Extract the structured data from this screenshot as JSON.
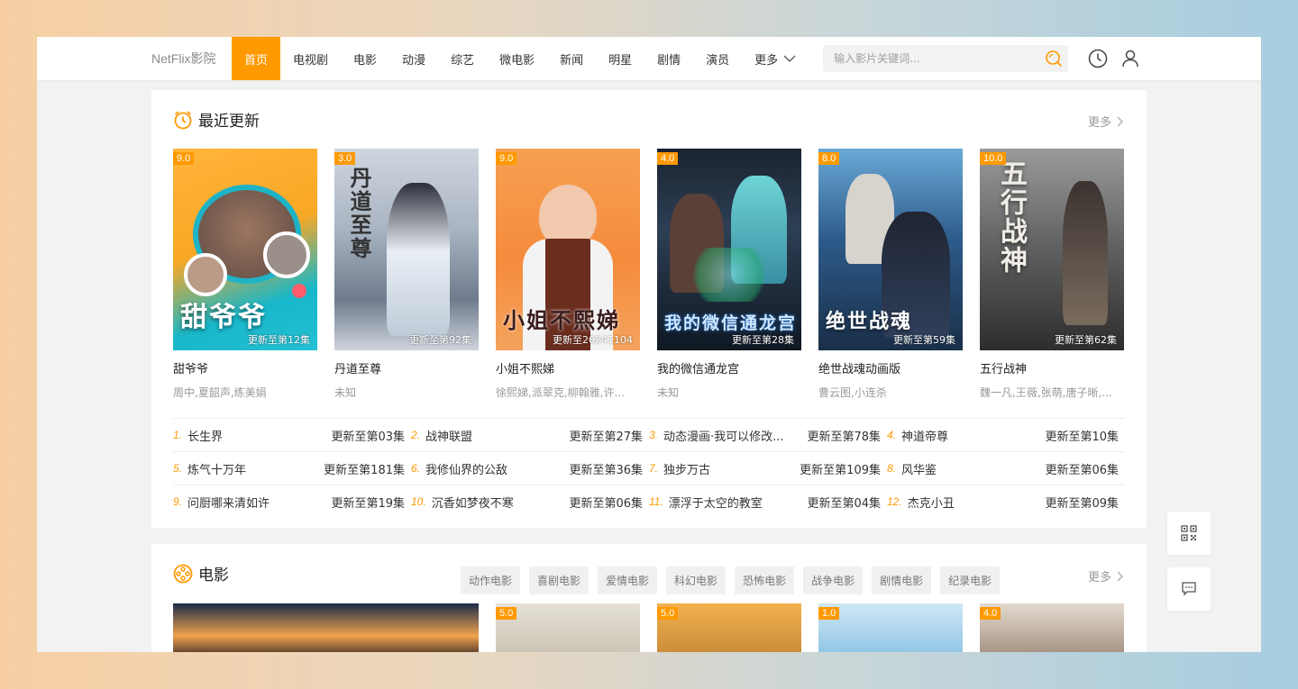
{
  "header": {
    "brand": "NetFlix影院",
    "nav": [
      {
        "label": "首页",
        "active": true
      },
      {
        "label": "电视剧"
      },
      {
        "label": "电影"
      },
      {
        "label": "动漫"
      },
      {
        "label": "综艺"
      },
      {
        "label": "微电影"
      },
      {
        "label": "新闻"
      },
      {
        "label": "明星"
      },
      {
        "label": "剧情"
      },
      {
        "label": "演员"
      },
      {
        "label": "更多"
      }
    ],
    "search_placeholder": "输入影片关键词..."
  },
  "recent": {
    "title": "最近更新",
    "more": "更多",
    "cards": [
      {
        "score": "9.0",
        "update": "更新至第12集",
        "art": "甜爷爷",
        "name": "甜爷爷",
        "actors": "周中,夏韶声,练美娟"
      },
      {
        "score": "3.0",
        "update": "更新至第92集",
        "art": "丹道至尊",
        "name": "丹道至尊",
        "actors": "未知"
      },
      {
        "score": "9.0",
        "update": "更新至20241104",
        "art": "小姐不熙娣",
        "name": "小姐不熙娣",
        "actors": "徐熙娣,派翠克,柳翰雅,许..."
      },
      {
        "score": "4.0",
        "update": "更新至第28集",
        "art": "我的微信通龙宫",
        "name": "我的微信通龙宫",
        "actors": "未知"
      },
      {
        "score": "8.0",
        "update": "更新至第59集",
        "art": "绝世战魂",
        "name": "绝世战魂动画版",
        "actors": "曹云图,小连杀"
      },
      {
        "score": "10.0",
        "update": "更新至第62集",
        "art": "五行战神",
        "name": "五行战神",
        "actors": "魏一凡,王薇,张萌,唐子晰,..."
      }
    ],
    "ranking": [
      {
        "num": "1.",
        "name": "长生界",
        "update": "更新至第03集"
      },
      {
        "num": "2.",
        "name": "战神联盟",
        "update": "更新至第27集"
      },
      {
        "num": "3.",
        "name": "动态漫画·我可以修改...",
        "update": "更新至第78集"
      },
      {
        "num": "4.",
        "name": "神道帝尊",
        "update": "更新至第10集"
      },
      {
        "num": "5.",
        "name": "炼气十万年",
        "update": "更新至第181集"
      },
      {
        "num": "6.",
        "name": "我修仙界的公敌",
        "update": "更新至第36集"
      },
      {
        "num": "7.",
        "name": "独步万古",
        "update": "更新至第109集"
      },
      {
        "num": "8.",
        "name": "风华鉴",
        "update": "更新至第06集"
      },
      {
        "num": "9.",
        "name": "问厨哪来清如许",
        "update": "更新至第19集"
      },
      {
        "num": "10.",
        "name": "沉香如梦夜不寒",
        "update": "更新至第06集"
      },
      {
        "num": "11.",
        "name": "漂浮于太空的教室",
        "update": "更新至第04集"
      },
      {
        "num": "12.",
        "name": "杰克小丑",
        "update": "更新至第09集"
      }
    ]
  },
  "movie": {
    "title": "电影",
    "more": "更多",
    "tags": [
      "动作电影",
      "喜剧电影",
      "爱情电影",
      "科幻电影",
      "恐怖电影",
      "战争电影",
      "剧情电影",
      "纪录电影"
    ],
    "cards": [
      {
        "score": ""
      },
      {
        "score": "5.0"
      },
      {
        "score": "5.0"
      },
      {
        "score": "1.0"
      },
      {
        "score": "4.0"
      }
    ]
  },
  "colors": {
    "accent": "#ff9900"
  }
}
